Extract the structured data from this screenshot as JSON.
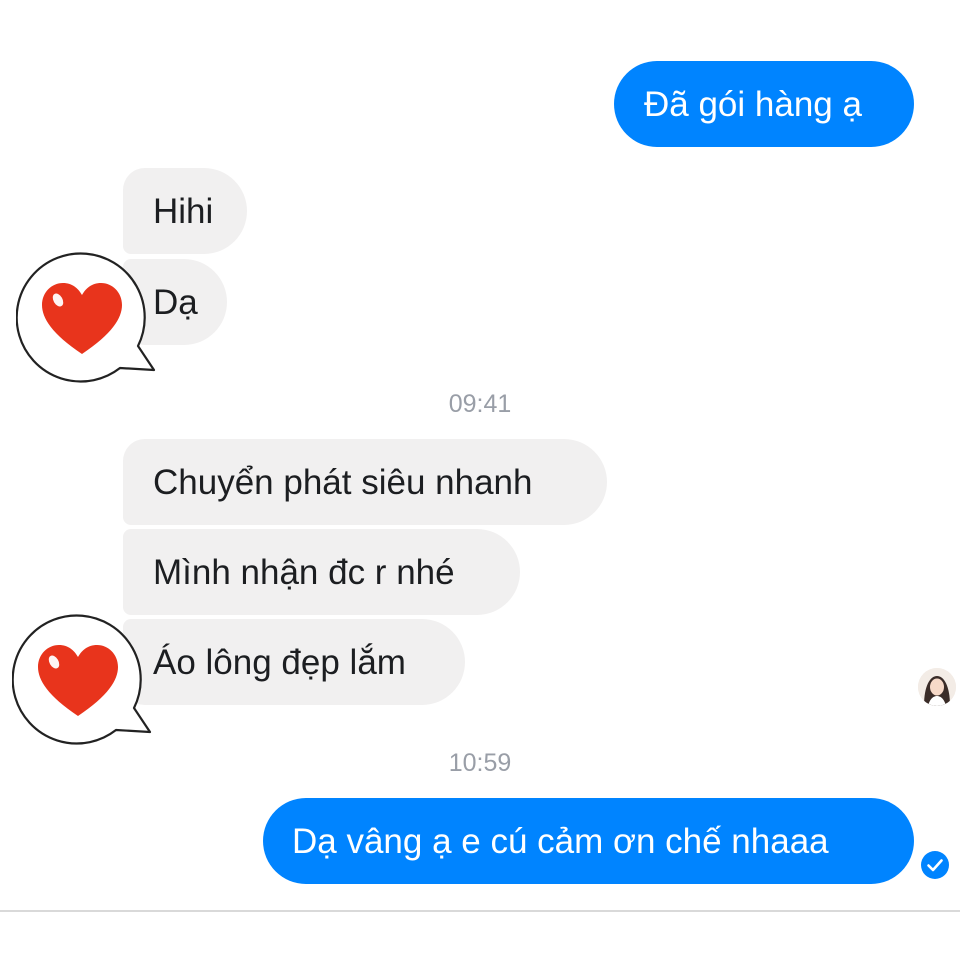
{
  "conversation": {
    "messages": [
      {
        "direction": "outgoing",
        "text": "Đã gói hàng ạ"
      },
      {
        "direction": "incoming",
        "text": "Hihi"
      },
      {
        "direction": "incoming",
        "text": "Dạ"
      },
      {
        "direction": "incoming",
        "text": "Chuyển phát siêu nhanh"
      },
      {
        "direction": "incoming",
        "text": "Mình nhận đc r nhé"
      },
      {
        "direction": "incoming",
        "text": "Áo lông đẹp lắm"
      },
      {
        "direction": "outgoing",
        "text": "Dạ vâng ạ e cú cảm ơn chế nhaaa"
      }
    ],
    "timestamps": [
      "09:41",
      "10:59"
    ]
  },
  "stickers": [
    {
      "icon": "heart-speech-bubble-icon",
      "color": "#e8341c"
    },
    {
      "icon": "heart-speech-bubble-icon",
      "color": "#e8341c"
    }
  ],
  "icons": {
    "seen_avatar": "seen-avatar",
    "sent_status": "sent-check-icon"
  },
  "colors": {
    "outgoing_bubble": "#0084ff",
    "incoming_bubble": "#f1f0f0",
    "timestamp_text": "#999ea7"
  }
}
